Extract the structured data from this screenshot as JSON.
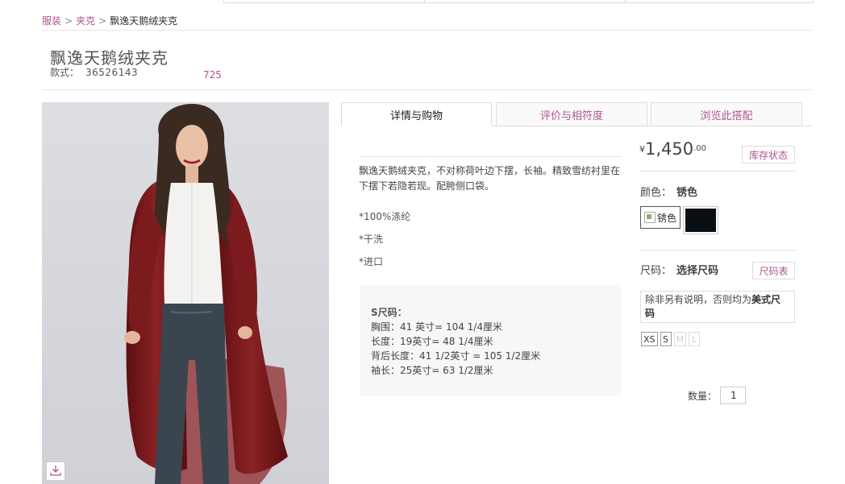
{
  "breadcrumb": {
    "item1": "服装",
    "item2": "夹克",
    "current": "飘逸天鹅绒夹克",
    "sep": ">"
  },
  "product": {
    "title": "飘逸天鹅绒夹克",
    "style_label": "款式：",
    "style_number": "36526143",
    "count": "725"
  },
  "tabs": [
    "详情与购物",
    "评价与相符度",
    "浏览此搭配"
  ],
  "details": {
    "description": "飘逸天鹅绒夹克，不对称荷叶边下摆，长袖。精致雪纺衬里在下摆下若隐若现。配胯侧口袋。",
    "features": [
      "*100%涤纶",
      "*干洗",
      "*进口"
    ],
    "size_chart": {
      "heading": "S尺码：",
      "rows": [
        "胸围：41 英寸= 104 1/4厘米",
        "长度：19英寸= 48 1/4厘米",
        "背后长度：41 1/2英寸 = 105 1/2厘米",
        "袖长：25英寸= 63 1/2厘米"
      ]
    }
  },
  "purchase": {
    "currency": "¥",
    "price": "1,450",
    "cents": ".00",
    "stock_button": "库存状态",
    "color_label": "颜色：",
    "color_value": "锈色",
    "swatch_alt": "锈色",
    "size_label": "尺码：",
    "size_value": "选择尺码",
    "size_chart_button": "尺码表",
    "note_prefix": "除非另有说明，否则均为",
    "note_bold": "美式尺码",
    "sizes": [
      {
        "label": "XS",
        "available": true
      },
      {
        "label": "S",
        "available": true
      },
      {
        "label": "M",
        "available": false
      },
      {
        "label": "L",
        "available": false
      }
    ],
    "quantity_label": "数量：",
    "quantity_value": "1"
  },
  "colors": {
    "accent": "#b0558a",
    "jacket": "#7a1a1c",
    "swatch_dark": "#0a0f14"
  },
  "icons": {
    "download": "download-icon"
  }
}
